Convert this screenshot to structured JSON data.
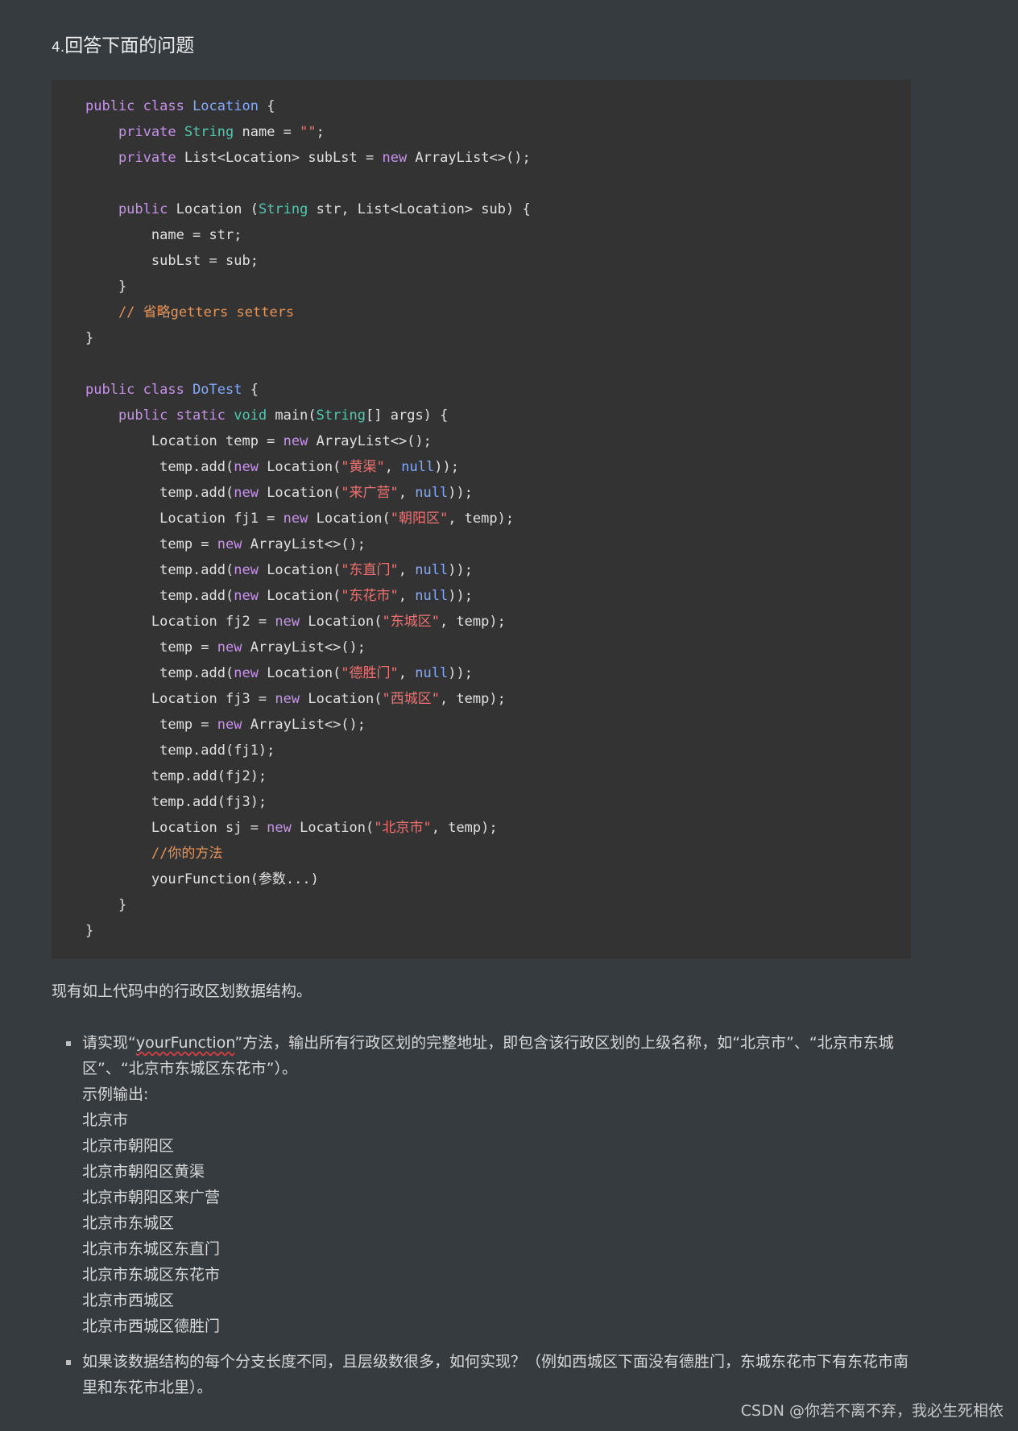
{
  "heading": {
    "number": "4.",
    "text": "回答下面的问题"
  },
  "code_lines": [
    [
      {
        "t": "public class ",
        "c": "kw"
      },
      {
        "t": "Location",
        "c": "cls"
      },
      {
        "t": " {",
        "c": ""
      }
    ],
    [
      {
        "t": "    private ",
        "c": "kw"
      },
      {
        "t": "String",
        "c": "ty"
      },
      {
        "t": " name = ",
        "c": ""
      },
      {
        "t": "\"\"",
        "c": "str"
      },
      {
        "t": ";",
        "c": ""
      }
    ],
    [
      {
        "t": "    private ",
        "c": "kw"
      },
      {
        "t": "List<Location> subLst = ",
        "c": ""
      },
      {
        "t": "new",
        "c": "kw"
      },
      {
        "t": " ArrayList<>();",
        "c": ""
      }
    ],
    [],
    [
      {
        "t": "    public ",
        "c": "kw"
      },
      {
        "t": "Location (",
        "c": ""
      },
      {
        "t": "String",
        "c": "ty"
      },
      {
        "t": " str, List<Location> sub) {",
        "c": ""
      }
    ],
    [
      {
        "t": "        name = str;",
        "c": ""
      }
    ],
    [
      {
        "t": "        subLst = sub;",
        "c": ""
      }
    ],
    [
      {
        "t": "    }",
        "c": ""
      }
    ],
    [
      {
        "t": "    // 省略getters setters",
        "c": "cm"
      }
    ],
    [
      {
        "t": "}",
        "c": ""
      }
    ],
    [],
    [
      {
        "t": "public class ",
        "c": "kw"
      },
      {
        "t": "DoTest",
        "c": "cls"
      },
      {
        "t": " {",
        "c": ""
      }
    ],
    [
      {
        "t": "    public static ",
        "c": "kw"
      },
      {
        "t": "void",
        "c": "ty"
      },
      {
        "t": " main(",
        "c": ""
      },
      {
        "t": "String",
        "c": "ty"
      },
      {
        "t": "[] args) {",
        "c": ""
      }
    ],
    [
      {
        "t": "        Location temp = ",
        "c": ""
      },
      {
        "t": "new",
        "c": "kw"
      },
      {
        "t": " ArrayList<>();",
        "c": ""
      }
    ],
    [
      {
        "t": "         temp.add(",
        "c": ""
      },
      {
        "t": "new",
        "c": "kw"
      },
      {
        "t": " Location(",
        "c": ""
      },
      {
        "t": "\"黄渠\"",
        "c": "str"
      },
      {
        "t": ", ",
        "c": ""
      },
      {
        "t": "null",
        "c": "lit"
      },
      {
        "t": "));",
        "c": ""
      }
    ],
    [
      {
        "t": "         temp.add(",
        "c": ""
      },
      {
        "t": "new",
        "c": "kw"
      },
      {
        "t": " Location(",
        "c": ""
      },
      {
        "t": "\"来广营\"",
        "c": "str"
      },
      {
        "t": ", ",
        "c": ""
      },
      {
        "t": "null",
        "c": "lit"
      },
      {
        "t": "));",
        "c": ""
      }
    ],
    [
      {
        "t": "         Location fj1 = ",
        "c": ""
      },
      {
        "t": "new",
        "c": "kw"
      },
      {
        "t": " Location(",
        "c": ""
      },
      {
        "t": "\"朝阳区\"",
        "c": "str"
      },
      {
        "t": ", temp);",
        "c": ""
      }
    ],
    [
      {
        "t": "         temp = ",
        "c": ""
      },
      {
        "t": "new",
        "c": "kw"
      },
      {
        "t": " ArrayList<>();",
        "c": ""
      }
    ],
    [
      {
        "t": "         temp.add(",
        "c": ""
      },
      {
        "t": "new",
        "c": "kw"
      },
      {
        "t": " Location(",
        "c": ""
      },
      {
        "t": "\"东直门\"",
        "c": "str"
      },
      {
        "t": ", ",
        "c": ""
      },
      {
        "t": "null",
        "c": "lit"
      },
      {
        "t": "));",
        "c": ""
      }
    ],
    [
      {
        "t": "         temp.add(",
        "c": ""
      },
      {
        "t": "new",
        "c": "kw"
      },
      {
        "t": " Location(",
        "c": ""
      },
      {
        "t": "\"东花市\"",
        "c": "str"
      },
      {
        "t": ", ",
        "c": ""
      },
      {
        "t": "null",
        "c": "lit"
      },
      {
        "t": "));",
        "c": ""
      }
    ],
    [
      {
        "t": "        Location fj2 = ",
        "c": ""
      },
      {
        "t": "new",
        "c": "kw"
      },
      {
        "t": " Location(",
        "c": ""
      },
      {
        "t": "\"东城区\"",
        "c": "str"
      },
      {
        "t": ", temp);",
        "c": ""
      }
    ],
    [
      {
        "t": "         temp = ",
        "c": ""
      },
      {
        "t": "new",
        "c": "kw"
      },
      {
        "t": " ArrayList<>();",
        "c": ""
      }
    ],
    [
      {
        "t": "         temp.add(",
        "c": ""
      },
      {
        "t": "new",
        "c": "kw"
      },
      {
        "t": " Location(",
        "c": ""
      },
      {
        "t": "\"德胜门\"",
        "c": "str"
      },
      {
        "t": ", ",
        "c": ""
      },
      {
        "t": "null",
        "c": "lit"
      },
      {
        "t": "));",
        "c": ""
      }
    ],
    [
      {
        "t": "        Location fj3 = ",
        "c": ""
      },
      {
        "t": "new",
        "c": "kw"
      },
      {
        "t": " Location(",
        "c": ""
      },
      {
        "t": "\"西城区\"",
        "c": "str"
      },
      {
        "t": ", temp);",
        "c": ""
      }
    ],
    [
      {
        "t": "         temp = ",
        "c": ""
      },
      {
        "t": "new",
        "c": "kw"
      },
      {
        "t": " ArrayList<>();",
        "c": ""
      }
    ],
    [
      {
        "t": "         temp.add(fj1);",
        "c": ""
      }
    ],
    [
      {
        "t": "        temp.add(fj2);",
        "c": ""
      }
    ],
    [
      {
        "t": "        temp.add(fj3);",
        "c": ""
      }
    ],
    [
      {
        "t": "        Location sj = ",
        "c": ""
      },
      {
        "t": "new",
        "c": "kw"
      },
      {
        "t": " Location(",
        "c": ""
      },
      {
        "t": "\"北京市\"",
        "c": "str"
      },
      {
        "t": ", temp);",
        "c": ""
      }
    ],
    [
      {
        "t": "        //你的方法",
        "c": "cm"
      }
    ],
    [
      {
        "t": "        yourFunction(参数...)",
        "c": ""
      }
    ],
    [
      {
        "t": "    }",
        "c": ""
      }
    ],
    [
      {
        "t": "}",
        "c": ""
      }
    ]
  ],
  "intro_paragraph": "现有如上代码中的行政区划数据结构。",
  "list": {
    "item1": {
      "before": "请实现“",
      "underlined": "yourFunction",
      "after": "”方法，输出所有行政区划的完整地址，即包含该行政区划的上级名称，如“北京市”、“北京市东城区”、“北京市东城区东花市”）。",
      "example_label": "示例输出:",
      "outputs": [
        "北京市",
        "北京市朝阳区",
        "北京市朝阳区黄渠",
        "北京市朝阳区来广营",
        "北京市东城区",
        "北京市东城区东直门",
        "北京市东城区东花市",
        "北京市西城区",
        "北京市西城区德胜门"
      ]
    },
    "item2": "如果该数据结构的每个分支长度不同，且层级数很多，如何实现？（例如西城区下面没有德胜门，东城东花市下有东花市南里和东花市北里）。"
  },
  "watermark": "CSDN @你若不离不弃，我必生死相依",
  "colors": {
    "background": "#363b40",
    "code_background": "#333333",
    "keyword": "#c792ea",
    "type": "#4ec9b0",
    "class_name": "#82aaff",
    "string": "#f07171",
    "comment": "#e5955a"
  }
}
